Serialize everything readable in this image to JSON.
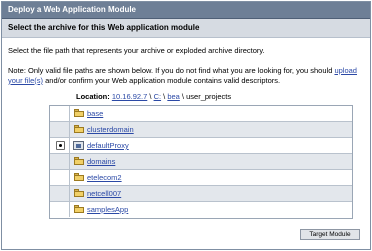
{
  "window": {
    "title": "Deploy a Web Application Module"
  },
  "section": {
    "heading": "Select the archive for this Web application module"
  },
  "instruction": "Select the file path that represents your archive or exploded archive directory.",
  "note": {
    "before": "Note: Only valid file paths are shown below. If you do not find what you are looking for, you should ",
    "link": "upload your file(s)",
    "after": " and/or confirm your Web application module contains valid descriptors."
  },
  "location": {
    "label": "Location:",
    "host": "10.16.92.7",
    "sep1": " \\ ",
    "drive": "C:",
    "sep2": " \\ ",
    "bea": "bea",
    "sep3": " \\ ",
    "current": "user_projects"
  },
  "entries": [
    {
      "name": "base",
      "type": "folder",
      "selectable": false
    },
    {
      "name": "clusterdomain",
      "type": "folder",
      "selectable": false
    },
    {
      "name": "defaultProxy",
      "type": "application",
      "selectable": true,
      "selected": true
    },
    {
      "name": "domains",
      "type": "folder",
      "selectable": false
    },
    {
      "name": "etelecom2",
      "type": "folder",
      "selectable": false
    },
    {
      "name": "netcell007",
      "type": "folder",
      "selectable": false
    },
    {
      "name": "samplesApp",
      "type": "folder",
      "selectable": false
    }
  ],
  "actions": {
    "target_module": "Target Module"
  },
  "colors": {
    "titlebar": "#6e7f96",
    "section_band": "#d6dbe2",
    "link": "#2b49a6",
    "row_shade": "#e3e7ec",
    "folder": "#f1d067"
  },
  "icons": {
    "folder": "folder-icon",
    "application": "web-application-icon"
  }
}
